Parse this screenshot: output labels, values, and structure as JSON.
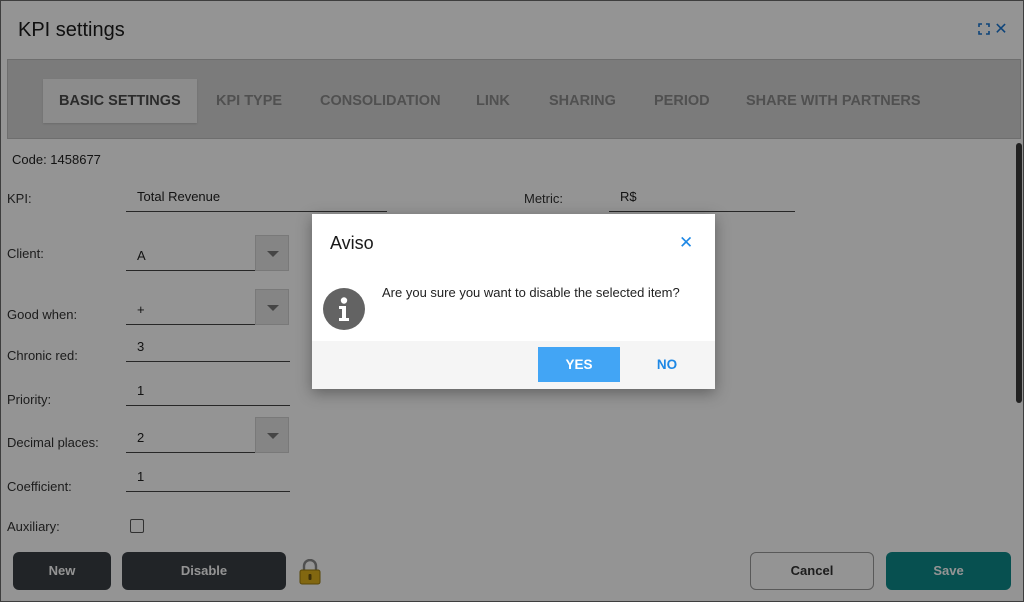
{
  "window": {
    "title": "KPI settings",
    "maximize_icon": "expand-icon",
    "close_icon": "close-icon"
  },
  "tabs": [
    {
      "label": "BASIC SETTINGS",
      "active": true
    },
    {
      "label": "KPI TYPE",
      "active": false
    },
    {
      "label": "CONSOLIDATION",
      "active": false
    },
    {
      "label": "LINK",
      "active": false
    },
    {
      "label": "SHARING",
      "active": false
    },
    {
      "label": "PERIOD",
      "active": false
    },
    {
      "label": "SHARE WITH PARTNERS",
      "active": false
    }
  ],
  "form": {
    "code": "Code: 1458677",
    "kpi": {
      "label": "KPI:",
      "value": "Total Revenue"
    },
    "metric": {
      "label": "Metric:",
      "value": "R$"
    },
    "client": {
      "label": "Client:",
      "value": "A"
    },
    "good_when": {
      "label": "Good when:",
      "value": "+"
    },
    "chronic_red": {
      "label": "Chronic red:",
      "value": "3"
    },
    "priority": {
      "label": "Priority:",
      "value": "1"
    },
    "decimal_places": {
      "label": "Decimal places:",
      "value": "2"
    },
    "coefficient": {
      "label": "Coefficient:",
      "value": "1"
    },
    "auxiliary": {
      "label": "Auxiliary:",
      "checked": false
    }
  },
  "footer": {
    "new_label": "New",
    "disable_label": "Disable",
    "cancel_label": "Cancel",
    "save_label": "Save",
    "lock_icon": "lock-icon"
  },
  "dialog": {
    "title": "Aviso",
    "message": "Are you sure you want to disable the selected item?",
    "yes_label": "YES",
    "no_label": "NO",
    "icon": "info-icon"
  },
  "colors": {
    "tab_bar": "#d4d4d4",
    "dark_button": "#3a3f44",
    "save_button": "#0d8a8a",
    "yes_button": "#42a5f5",
    "link_blue": "#1e88e5"
  }
}
